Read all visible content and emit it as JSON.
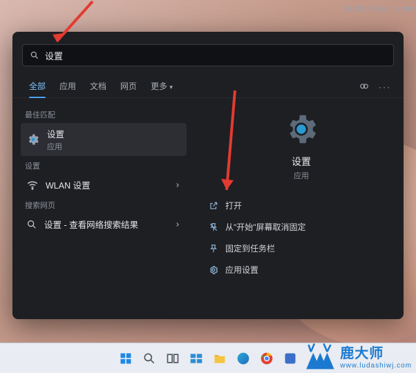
{
  "watermark": "ludashiwj.com",
  "search": {
    "value": "设置"
  },
  "tabs": {
    "items": [
      "全部",
      "应用",
      "文档",
      "网页",
      "更多"
    ],
    "active_index": 0
  },
  "left": {
    "best_match_label": "最佳匹配",
    "best_match": {
      "title": "设置",
      "subtitle": "应用"
    },
    "settings_label": "设置",
    "wlan": {
      "title": "WLAN 设置"
    },
    "web_label": "搜索网页",
    "web": {
      "title": "设置 - 查看网络搜索结果"
    }
  },
  "right": {
    "title": "设置",
    "subtitle": "应用",
    "actions": [
      {
        "icon": "open-icon",
        "label": "打开"
      },
      {
        "icon": "unpin-start-icon",
        "label": "从\"开始\"屏幕取消固定"
      },
      {
        "icon": "pin-taskbar-icon",
        "label": "固定到任务栏"
      },
      {
        "icon": "app-settings-icon",
        "label": "应用设置"
      }
    ]
  },
  "brand": {
    "name": "鹿大师",
    "url": "www.ludashiwj.com"
  }
}
